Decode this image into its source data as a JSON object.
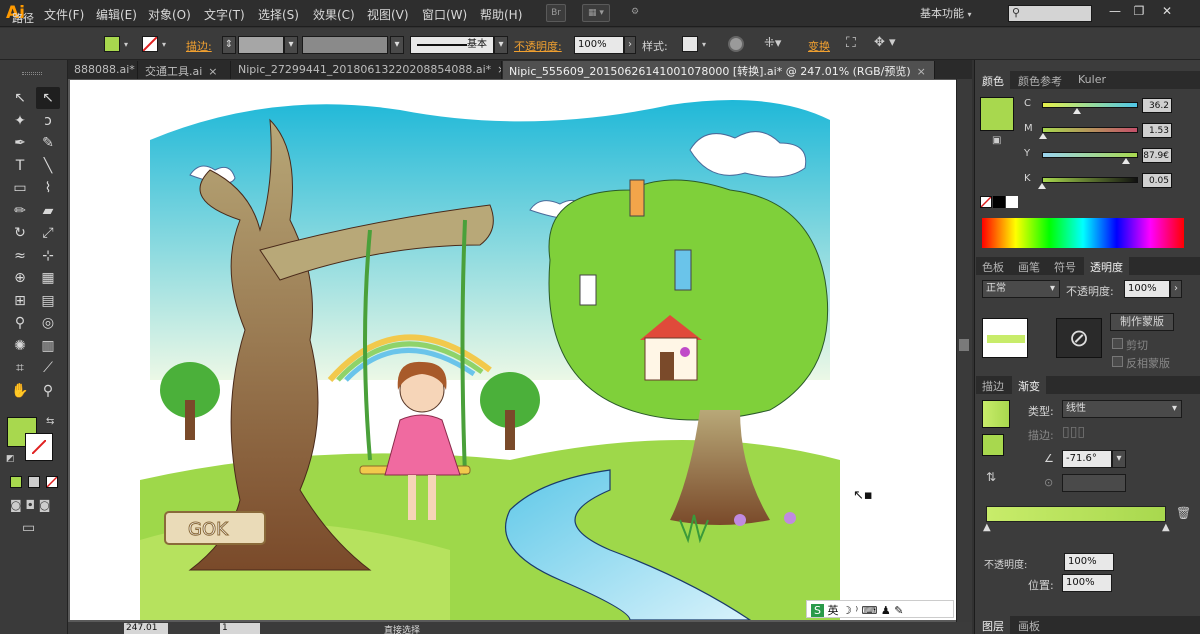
{
  "app": {
    "logo": "Ai",
    "menus": [
      "文件(F)",
      "编辑(E)",
      "对象(O)",
      "文字(T)",
      "选择(S)",
      "效果(C)",
      "视图(V)",
      "窗口(W)",
      "帮助(H)"
    ],
    "bridge_label": "Br",
    "workspace_label": "基本功能",
    "window_controls": [
      "—",
      "❐",
      "✕"
    ]
  },
  "control_bar": {
    "object_type": "路径",
    "stroke_label": "描边:",
    "stroke_profile": "基本",
    "opacity_label": "不透明度:",
    "opacity_value": "100%",
    "style_label": "样式:",
    "transform_label": "变换",
    "fill_color": "#a8d84e"
  },
  "tabs": [
    {
      "label": "888088.ai*",
      "active": false
    },
    {
      "label": "交通工具.ai",
      "active": false
    },
    {
      "label": "Nipic_27299441_20180613220208854088.ai*",
      "active": false
    },
    {
      "label": "Nipic_555609_20150626141001078000 [转换].ai* @ 247.01% (RGB/预览)",
      "active": true
    }
  ],
  "tools": [
    {
      "icon": "selection-tool-icon",
      "glyph": "↖"
    },
    {
      "icon": "direct-selection-tool-icon",
      "glyph": "↖"
    },
    {
      "icon": "magic-wand-tool-icon",
      "glyph": "✦"
    },
    {
      "icon": "lasso-tool-icon",
      "glyph": "ↄ"
    },
    {
      "icon": "pen-tool-icon",
      "glyph": "✒"
    },
    {
      "icon": "curvature-tool-icon",
      "glyph": "✎"
    },
    {
      "icon": "type-tool-icon",
      "glyph": "T"
    },
    {
      "icon": "line-tool-icon",
      "glyph": "╲"
    },
    {
      "icon": "rectangle-tool-icon",
      "glyph": "▭"
    },
    {
      "icon": "paintbrush-tool-icon",
      "glyph": "⌇"
    },
    {
      "icon": "pencil-tool-icon",
      "glyph": "✏"
    },
    {
      "icon": "eraser-tool-icon",
      "glyph": "▰"
    },
    {
      "icon": "rotate-tool-icon",
      "glyph": "↻"
    },
    {
      "icon": "scale-tool-icon",
      "glyph": "⤢"
    },
    {
      "icon": "warp-tool-icon",
      "glyph": "≈"
    },
    {
      "icon": "free-transform-tool-icon",
      "glyph": "⊹"
    },
    {
      "icon": "shape-builder-tool-icon",
      "glyph": "⊕"
    },
    {
      "icon": "perspective-grid-tool-icon",
      "glyph": "▦"
    },
    {
      "icon": "mesh-tool-icon",
      "glyph": "⊞"
    },
    {
      "icon": "gradient-tool-icon",
      "glyph": "▤"
    },
    {
      "icon": "eyedropper-tool-icon",
      "glyph": "⚲"
    },
    {
      "icon": "blend-tool-icon",
      "glyph": "◎"
    },
    {
      "icon": "symbol-sprayer-tool-icon",
      "glyph": "✺"
    },
    {
      "icon": "column-graph-tool-icon",
      "glyph": "▥"
    },
    {
      "icon": "artboard-tool-icon",
      "glyph": "⌗"
    },
    {
      "icon": "slice-tool-icon",
      "glyph": "⟋"
    },
    {
      "icon": "hand-tool-icon",
      "glyph": "✋"
    },
    {
      "icon": "zoom-tool-icon",
      "glyph": "⚲"
    }
  ],
  "color_panel": {
    "tabs": [
      "颜色",
      "颜色参考",
      "Kuler"
    ],
    "swatch": "#a8d84e",
    "channels": [
      {
        "label": "C",
        "value": "36.2",
        "fraction": 0.362,
        "gradient": "linear-gradient(90deg,#e6f04a,#4fc6e8)"
      },
      {
        "label": "M",
        "value": "1.53",
        "fraction": 0.015,
        "gradient": "linear-gradient(90deg,#a8d84e,#c4506a)"
      },
      {
        "label": "Y",
        "value": "87.9€",
        "fraction": 0.879,
        "gradient": "linear-gradient(90deg,#9ad4f0,#a8d84e)"
      },
      {
        "label": "K",
        "value": "0.05",
        "fraction": 0.0,
        "gradient": "linear-gradient(90deg,#a8d84e,#111111)"
      }
    ]
  },
  "transparency_panel": {
    "tabs": [
      "色板",
      "画笔",
      "符号",
      "透明度"
    ],
    "blend_mode": "正常",
    "opacity_label": "不透明度:",
    "opacity_value": "100%",
    "make_mask_button": "制作蒙版",
    "clip_label": "剪切",
    "invert_label": "反相蒙版"
  },
  "gradient_panel": {
    "tabs": [
      "描边",
      "渐变"
    ],
    "type_label": "类型:",
    "type_value": "线性",
    "stroke_label": "描边:",
    "angle_value": "-71.6°",
    "opacity_value": "100%",
    "position_label": "位置:",
    "position_value": "100%",
    "gradient": "linear-gradient(90deg,#c8ec6a,#a8d84e)"
  },
  "layers_panel": {
    "tabs": [
      "图层",
      "画板"
    ]
  },
  "status": {
    "zoom": "247.01",
    "page": "1",
    "tool_hint": "直接选择"
  },
  "artwork": {
    "sign_text": "GOK"
  }
}
